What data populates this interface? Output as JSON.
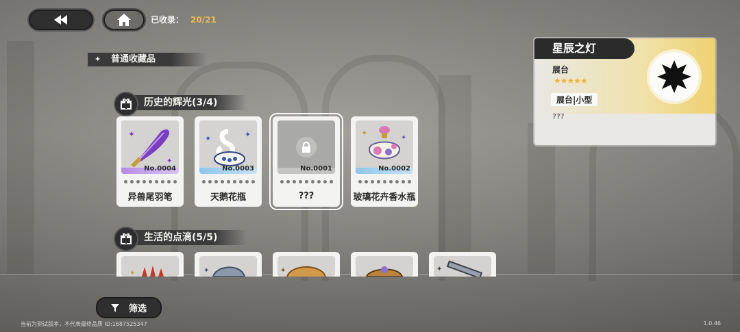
{
  "header": {
    "back_icon": "rewind-icon",
    "home_icon": "home-icon",
    "collected_label": "已收录：",
    "collected_value": "20/21"
  },
  "section": {
    "title": "普通收藏品",
    "icon": "sparkle-icon"
  },
  "categories": [
    {
      "title": "历史的辉光(3/4)",
      "icon": "gift-icon",
      "items": [
        {
          "no": "No.0004",
          "name": "异兽尾羽笔",
          "accent": "#b78be6",
          "icon": "feather-quill-icon"
        },
        {
          "no": "No.0003",
          "name": "天鹅花瓶",
          "accent": "#8ec6ea",
          "icon": "swan-vase-icon"
        },
        {
          "no": "No.0001",
          "name": "???",
          "accent": "#bdbdbb",
          "icon": "lock-icon"
        },
        {
          "no": "No.0002",
          "name": "玻璃花卉香水瓶",
          "accent": "#8ec6ea",
          "icon": "perfume-bottle-icon"
        }
      ]
    },
    {
      "title": "生活的点滴(5/5)",
      "icon": "gift-icon",
      "items": [
        {
          "icon": "candles-icon"
        },
        {
          "icon": "shell-icon"
        },
        {
          "icon": "bread-icon"
        },
        {
          "icon": "basket-icon"
        },
        {
          "icon": "pen-icon"
        }
      ]
    }
  ],
  "detail": {
    "title": "星辰之灯",
    "label": "展台",
    "stars": "★★★★★",
    "tag": "展台|小型",
    "description": "???",
    "emblem_icon": "silhouette-icon"
  },
  "filter": {
    "label": "筛选",
    "icon": "funnel-icon"
  },
  "footer": {
    "note": "当前为测试版本，不代表最终品质 ID:1687525347",
    "version": "1.0.46"
  },
  "colors": {
    "gold": "#e6b95b",
    "panel_dark": "#2f2f30",
    "card_bg": "#f3f3f1"
  }
}
